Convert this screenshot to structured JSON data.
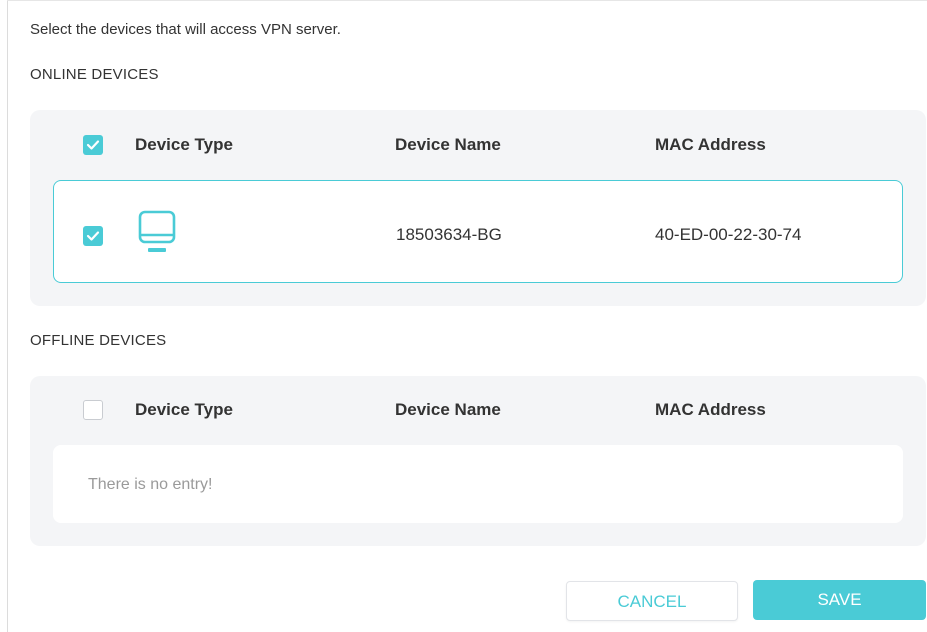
{
  "intro_text": "Select the devices that will access VPN server.",
  "online": {
    "title": "ONLINE DEVICES",
    "columns": [
      "Device Type",
      "Device Name",
      "MAC Address"
    ],
    "select_all_checked": true,
    "rows": [
      {
        "checked": true,
        "device_type_icon": "computer-monitor-icon",
        "device_name": "18503634-BG",
        "mac_address": "40-ED-00-22-30-74"
      }
    ]
  },
  "offline": {
    "title": "OFFLINE DEVICES",
    "columns": [
      "Device Type",
      "Device Name",
      "MAC Address"
    ],
    "select_all_checked": false,
    "empty_text": "There is no entry!"
  },
  "buttons": {
    "cancel_label": "CANCEL",
    "save_label": "SAVE"
  },
  "colors": {
    "accent": "#4acbd6",
    "panel_bg": "#f4f5f7",
    "empty_text": "#9a9a9a"
  }
}
